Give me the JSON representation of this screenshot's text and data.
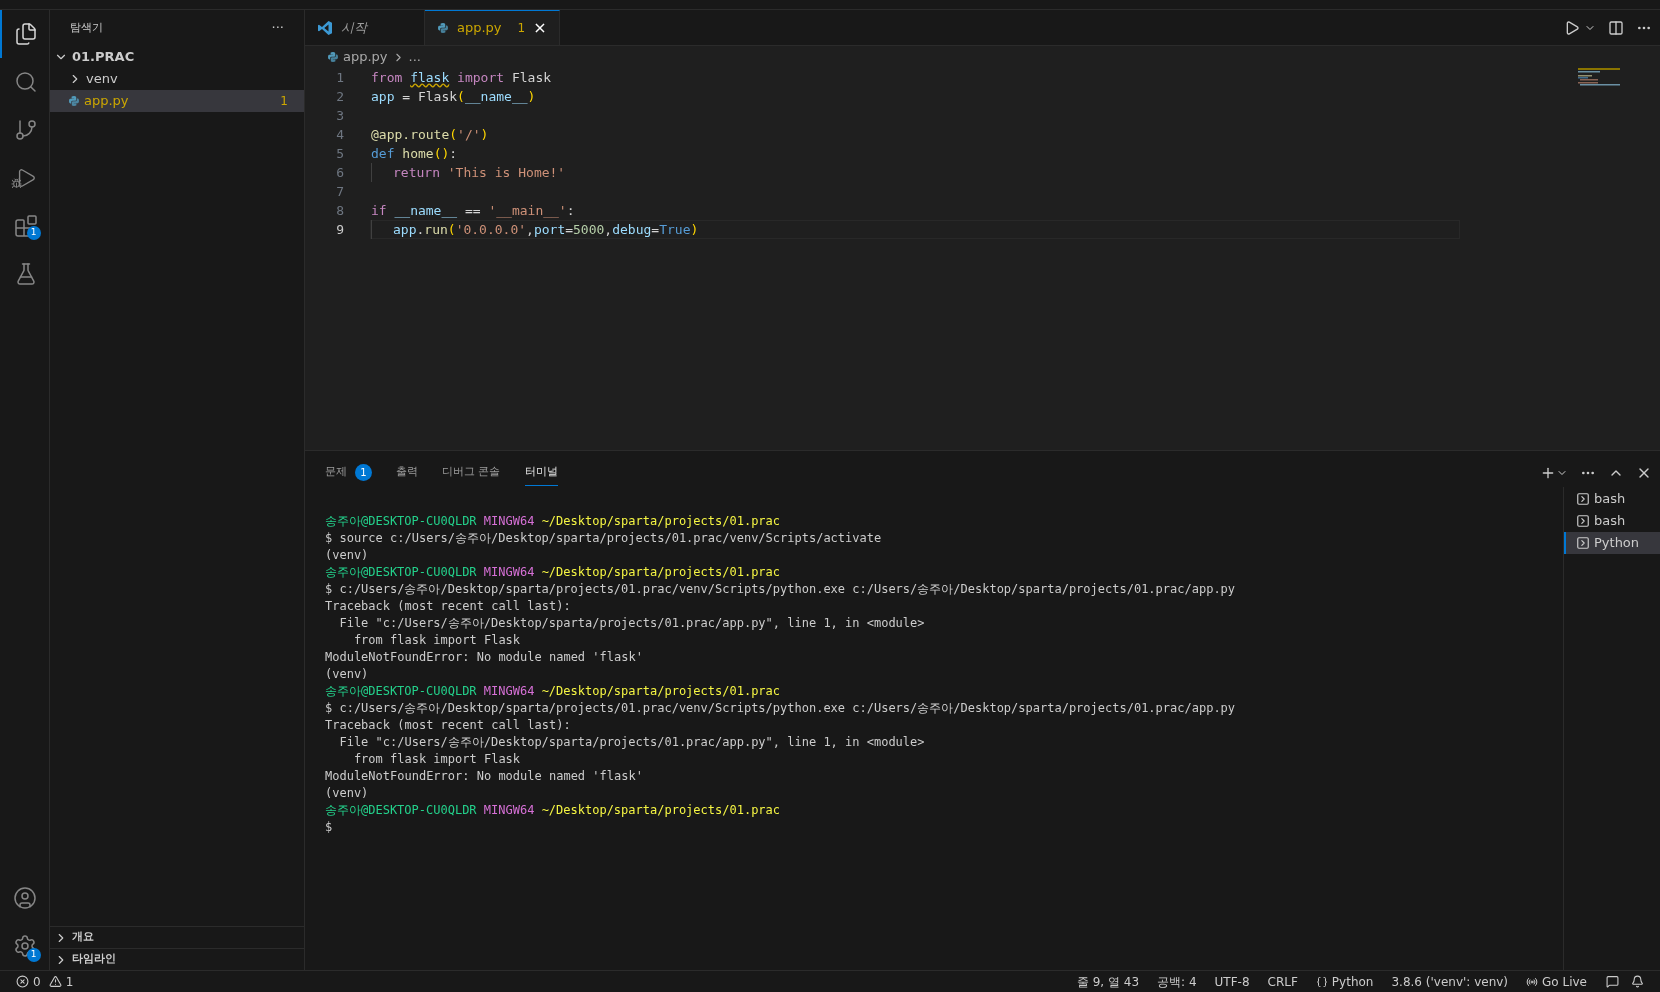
{
  "activity_bar": {
    "items": [
      {
        "kind": "files",
        "selected": true
      },
      {
        "kind": "search",
        "selected": false
      },
      {
        "kind": "source",
        "selected": false
      },
      {
        "kind": "run",
        "selected": false
      },
      {
        "kind": "extensions",
        "selected": false,
        "badge": "1"
      },
      {
        "kind": "testing",
        "selected": false
      }
    ],
    "bottom": [
      {
        "kind": "account"
      },
      {
        "kind": "settings",
        "badge": "1"
      }
    ]
  },
  "sidebar": {
    "title": "탐색기",
    "more": "···",
    "tree": [
      {
        "label": "01.PRAC",
        "kind": "folder",
        "expanded": true,
        "children": [
          {
            "label": "venv",
            "kind": "folder",
            "expanded": false
          },
          {
            "label": "app.py",
            "kind": "python",
            "selected": true,
            "badge": "1"
          }
        ]
      }
    ],
    "sections": [
      {
        "label": "개요",
        "expanded": false
      },
      {
        "label": "타임라인",
        "expanded": false
      }
    ]
  },
  "tabs": [
    {
      "label": "시작",
      "kind": "welcome",
      "selected": false
    },
    {
      "label": "app.py",
      "kind": "python",
      "selected": true,
      "badge": "1",
      "close": "×"
    }
  ],
  "breadcrumb": [
    "app.py",
    "..."
  ],
  "code": [
    {
      "number": "1",
      "current": false,
      "indented": false,
      "tokens": [
        {
          "text": "from ",
          "kind": "keyword"
        },
        {
          "text": "flask",
          "kind": "var",
          "squiggle": true
        },
        {
          "text": " import",
          "kind": "keyword"
        },
        {
          "text": " Flask",
          "kind": "plain"
        }
      ]
    },
    {
      "number": "2",
      "current": false,
      "indented": false,
      "tokens": [
        {
          "text": "app",
          "kind": "var"
        },
        {
          "text": " = ",
          "kind": "plain"
        },
        {
          "text": "Flask",
          "kind": "plain"
        },
        {
          "text": "(",
          "kind": "bracket"
        },
        {
          "text": "__name__",
          "kind": "var"
        },
        {
          "text": ")",
          "kind": "bracket"
        }
      ]
    },
    {
      "number": "3",
      "current": false,
      "indented": false
    },
    {
      "number": "4",
      "current": false,
      "indented": false,
      "tokens": [
        {
          "text": "@app.route",
          "kind": "func"
        },
        {
          "text": "(",
          "kind": "bracket"
        },
        {
          "text": "'/'",
          "kind": "string"
        },
        {
          "text": ")",
          "kind": "bracket"
        }
      ]
    },
    {
      "number": "5",
      "current": false,
      "indented": false,
      "tokens": [
        {
          "text": "def ",
          "kind": "def"
        },
        {
          "text": "home",
          "kind": "func"
        },
        {
          "text": "()",
          "kind": "bracket"
        },
        {
          "text": ":",
          "kind": "plain"
        }
      ]
    },
    {
      "number": "6",
      "current": false,
      "indented": true,
      "tokens": [
        {
          "text": "return ",
          "kind": "keyword"
        },
        {
          "text": "'This is Home!'",
          "kind": "string"
        }
      ]
    },
    {
      "number": "7",
      "current": false,
      "indented": false
    },
    {
      "number": "8",
      "current": false,
      "indented": false,
      "tokens": [
        {
          "text": "if ",
          "kind": "keyword"
        },
        {
          "text": "__name__",
          "kind": "var"
        },
        {
          "text": " == ",
          "kind": "plain"
        },
        {
          "text": "'__main__'",
          "kind": "string"
        },
        {
          "text": ":",
          "kind": "plain"
        }
      ]
    },
    {
      "number": "9",
      "current": true,
      "indented": true,
      "tokens": [
        {
          "text": "app",
          "kind": "var"
        },
        {
          "text": ".",
          "kind": "plain"
        },
        {
          "text": "run",
          "kind": "func"
        },
        {
          "text": "(",
          "kind": "bracket"
        },
        {
          "text": "'0.0.0.0'",
          "kind": "string"
        },
        {
          "text": ",",
          "kind": "plain"
        },
        {
          "text": "port",
          "kind": "var"
        },
        {
          "text": "=",
          "kind": "plain"
        },
        {
          "text": "5000",
          "kind": "number"
        },
        {
          "text": ",",
          "kind": "plain"
        },
        {
          "text": "debug",
          "kind": "var"
        },
        {
          "text": "=",
          "kind": "plain"
        },
        {
          "text": "True",
          "kind": "def"
        },
        {
          "text": ")",
          "kind": "bracket"
        }
      ]
    }
  ],
  "panel_tabs": [
    {
      "label": "문제",
      "selected": false,
      "badge": "1"
    },
    {
      "label": "출력",
      "selected": false
    },
    {
      "label": "디버그 콘솔",
      "selected": false
    },
    {
      "label": "터미널",
      "selected": true
    }
  ],
  "terminal": [
    [
      {
        "text": "송주아@DESKTOP-CU0QLDR",
        "kind": "user"
      },
      {
        "text": " MINGW64 ",
        "kind": "system"
      },
      {
        "text": "~/Desktop/sparta/projects/01.prac",
        "kind": "path"
      }
    ],
    [
      {
        "text": "$ source c:/Users/송주아/Desktop/sparta/projects/01.prac/venv/Scripts/activate",
        "kind": "plain"
      }
    ],
    [
      {
        "text": "(venv)",
        "kind": "plain"
      }
    ],
    [
      {
        "text": "송주아@DESKTOP-CU0QLDR",
        "kind": "user"
      },
      {
        "text": " MINGW64 ",
        "kind": "system"
      },
      {
        "text": "~/Desktop/sparta/projects/01.prac",
        "kind": "path"
      }
    ],
    [
      {
        "text": "$ c:/Users/송주아/Desktop/sparta/projects/01.prac/venv/Scripts/python.exe c:/Users/송주아/Desktop/sparta/projects/01.prac/app.py",
        "kind": "plain"
      }
    ],
    [
      {
        "text": "Traceback (most recent call last):",
        "kind": "plain"
      }
    ],
    [
      {
        "text": "  File \"c:/Users/송주아/Desktop/sparta/projects/01.prac/app.py\", line 1, in <module>",
        "kind": "plain"
      }
    ],
    [
      {
        "text": "    from flask import Flask",
        "kind": "plain"
      }
    ],
    [
      {
        "text": "ModuleNotFoundError: No module named 'flask'",
        "kind": "plain"
      }
    ],
    [
      {
        "text": "(venv)",
        "kind": "plain"
      }
    ],
    [
      {
        "text": "송주아@DESKTOP-CU0QLDR",
        "kind": "user"
      },
      {
        "text": " MINGW64 ",
        "kind": "system"
      },
      {
        "text": "~/Desktop/sparta/projects/01.prac",
        "kind": "path"
      }
    ],
    [
      {
        "text": "$ c:/Users/송주아/Desktop/sparta/projects/01.prac/venv/Scripts/python.exe c:/Users/송주아/Desktop/sparta/projects/01.prac/app.py",
        "kind": "plain"
      }
    ],
    [
      {
        "text": "Traceback (most recent call last):",
        "kind": "plain"
      }
    ],
    [
      {
        "text": "  File \"c:/Users/송주아/Desktop/sparta/projects/01.prac/app.py\", line 1, in <module>",
        "kind": "plain"
      }
    ],
    [
      {
        "text": "    from flask import Flask",
        "kind": "plain"
      }
    ],
    [
      {
        "text": "ModuleNotFoundError: No module named 'flask'",
        "kind": "plain"
      }
    ],
    [
      {
        "text": "(venv)",
        "kind": "plain"
      }
    ],
    [
      {
        "text": "송주아@DESKTOP-CU0QLDR",
        "kind": "user"
      },
      {
        "text": " MINGW64 ",
        "kind": "system"
      },
      {
        "text": "~/Desktop/sparta/projects/01.prac",
        "kind": "path"
      }
    ],
    [
      {
        "text": "$",
        "kind": "plain"
      }
    ]
  ],
  "terminals": [
    {
      "label": "bash",
      "selected": false
    },
    {
      "label": "bash",
      "selected": false
    },
    {
      "label": "Python",
      "selected": true
    }
  ],
  "status_bar": {
    "errors": "0",
    "warnings": "1",
    "right": [
      {
        "label": "줄 9, 열 43",
        "kind": "text"
      },
      {
        "label": "공백: 4",
        "kind": "text"
      },
      {
        "label": "UTF-8",
        "kind": "text"
      },
      {
        "label": "CRLF",
        "kind": "text"
      },
      {
        "label": "Python",
        "kind": "language"
      },
      {
        "label": "3.8.6 ('venv': venv)",
        "kind": "text"
      },
      {
        "label": "Go Live",
        "kind": "live"
      }
    ]
  }
}
